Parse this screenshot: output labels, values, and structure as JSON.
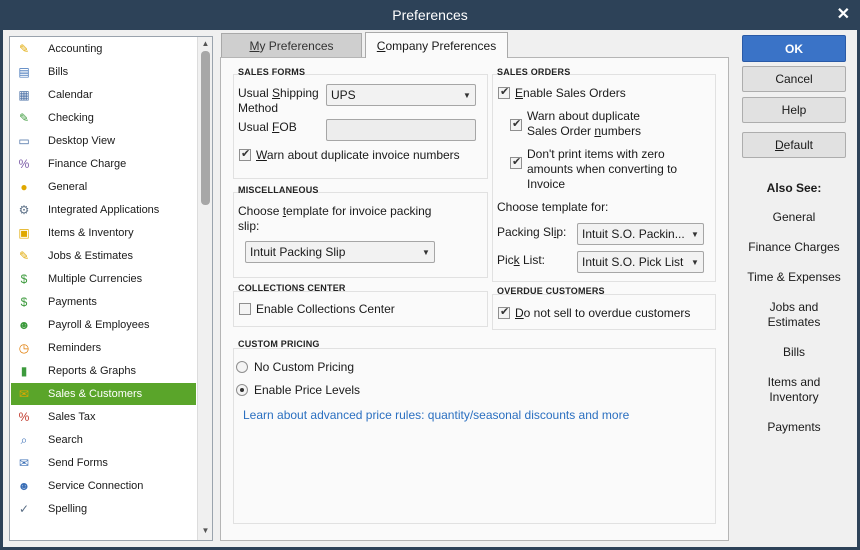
{
  "window": {
    "title": "Preferences",
    "close_glyph": "✕"
  },
  "sidebar": {
    "items": [
      {
        "label": "Accounting",
        "icon": "accounting-icon",
        "glyph": "✎",
        "color": "#e0a800"
      },
      {
        "label": "Bills",
        "icon": "bills-icon",
        "glyph": "▤",
        "color": "#3b6fb6"
      },
      {
        "label": "Calendar",
        "icon": "calendar-icon",
        "glyph": "▦",
        "color": "#4a6fa5"
      },
      {
        "label": "Checking",
        "icon": "checking-icon",
        "glyph": "✎",
        "color": "#3c9a3c"
      },
      {
        "label": "Desktop View",
        "icon": "desktop-view-icon",
        "glyph": "▭",
        "color": "#4a6fa5"
      },
      {
        "label": "Finance Charge",
        "icon": "finance-charge-icon",
        "glyph": "%",
        "color": "#7a5aa6"
      },
      {
        "label": "General",
        "icon": "general-icon",
        "glyph": "●",
        "color": "#e0a800"
      },
      {
        "label": "Integrated Applications",
        "icon": "integrated-applications-icon",
        "glyph": "⚙",
        "color": "#5b6f86"
      },
      {
        "label": "Items & Inventory",
        "icon": "items-inventory-icon",
        "glyph": "▣",
        "color": "#e0a800"
      },
      {
        "label": "Jobs & Estimates",
        "icon": "jobs-estimates-icon",
        "glyph": "✎",
        "color": "#e0a800"
      },
      {
        "label": "Multiple Currencies",
        "icon": "multiple-currencies-icon",
        "glyph": "$",
        "color": "#3c9a3c"
      },
      {
        "label": "Payments",
        "icon": "payments-icon",
        "glyph": "$",
        "color": "#3c9a3c"
      },
      {
        "label": "Payroll & Employees",
        "icon": "payroll-employees-icon",
        "glyph": "☻",
        "color": "#3c9a3c"
      },
      {
        "label": "Reminders",
        "icon": "reminders-icon",
        "glyph": "◷",
        "color": "#e07a00"
      },
      {
        "label": "Reports & Graphs",
        "icon": "reports-graphs-icon",
        "glyph": "▮",
        "color": "#3c9a3c"
      },
      {
        "label": "Sales & Customers",
        "icon": "sales-customers-icon",
        "glyph": "✉",
        "color": "#e0a800"
      },
      {
        "label": "Sales Tax",
        "icon": "sales-tax-icon",
        "glyph": "%",
        "color": "#c0392b"
      },
      {
        "label": "Search",
        "icon": "search-icon",
        "glyph": "⌕",
        "color": "#3b6fb6"
      },
      {
        "label": "Send Forms",
        "icon": "send-forms-icon",
        "glyph": "✉",
        "color": "#3b6fb6"
      },
      {
        "label": "Service Connection",
        "icon": "service-connection-icon",
        "glyph": "☻",
        "color": "#3b6fb6"
      },
      {
        "label": "Spelling",
        "icon": "spelling-icon",
        "glyph": "✓",
        "color": "#5b6f86"
      }
    ],
    "selected": "Sales & Customers"
  },
  "tabs": {
    "my_prefix": "",
    "my_hotkey": "M",
    "my_rest": "y Preferences",
    "company_hotkey": "C",
    "company_rest": "ompany Preferences"
  },
  "sales_forms": {
    "heading": "SALES FORMS",
    "shipping_a": "Usual ",
    "shipping_hot": "S",
    "shipping_b": "hipping",
    "shipping_line2": "Method",
    "shipping_value": "UPS",
    "fob_a": "Usual ",
    "fob_hot": "F",
    "fob_b": "OB",
    "fob_value": "",
    "warn_dup_a": "",
    "warn_dup_hot": "W",
    "warn_dup_b": "arn about duplicate invoice numbers",
    "warn_dup_checked": true
  },
  "misc": {
    "heading": "MISCELLANEOUS",
    "line1_a": "Choose ",
    "line1_hot": "t",
    "line1_b": "emplate for invoice packing",
    "line2": "slip:",
    "packing_value": "Intuit Packing Slip"
  },
  "collections": {
    "heading": "COLLECTIONS CENTER",
    "label": "Enable Collections Center",
    "checked": false
  },
  "custom_pricing": {
    "heading": "CUSTOM PRICING",
    "no_custom": "No Custom Pricing",
    "enable_levels": "Enable Price Levels",
    "selected": "Enable Price Levels",
    "learn_link": "Learn about advanced price rules: quantity/seasonal discounts and more"
  },
  "sales_orders": {
    "heading": "SALES ORDERS",
    "enable_a": "",
    "enable_hot": "E",
    "enable_b": "nable Sales Orders",
    "enable_checked": true,
    "warn_line1": "Warn about duplicate",
    "warn_line2_a": "Sales Order ",
    "warn_line2_hot": "n",
    "warn_line2_b": "umbers",
    "warn_checked": true,
    "noprint_line1": "Don't print items with zero",
    "noprint_line2": "amounts when converting to",
    "noprint_line3": "Invoice",
    "noprint_checked": true,
    "choose_template": "Choose template for:",
    "packing_label_a": "Packing Sl",
    "packing_label_hot": "i",
    "packing_label_b": "p:",
    "packing_value": "Intuit S.O. Packin...",
    "pick_label_a": "Pic",
    "pick_label_hot": "k",
    "pick_label_b": " List:",
    "pick_value": "Intuit S.O. Pick List"
  },
  "overdue": {
    "heading": "OVERDUE CUSTOMERS",
    "label_a": "",
    "label_hot": "D",
    "label_b": "o not sell to overdue customers",
    "checked": true
  },
  "buttons": {
    "ok": "OK",
    "cancel": "Cancel",
    "help": "Help",
    "default_hot": "D",
    "default_rest": "efault"
  },
  "also_see": {
    "heading": "Also See:",
    "links": [
      "General",
      "Finance Charges",
      "Time & Expenses",
      "Jobs and Estimates",
      "Bills",
      "Items and Inventory",
      "Payments"
    ]
  },
  "colors": {
    "titlebar": "#2d4258",
    "selected_item": "#5aa52a",
    "ok_button": "#3a73c7",
    "link": "#2a6fc0"
  }
}
